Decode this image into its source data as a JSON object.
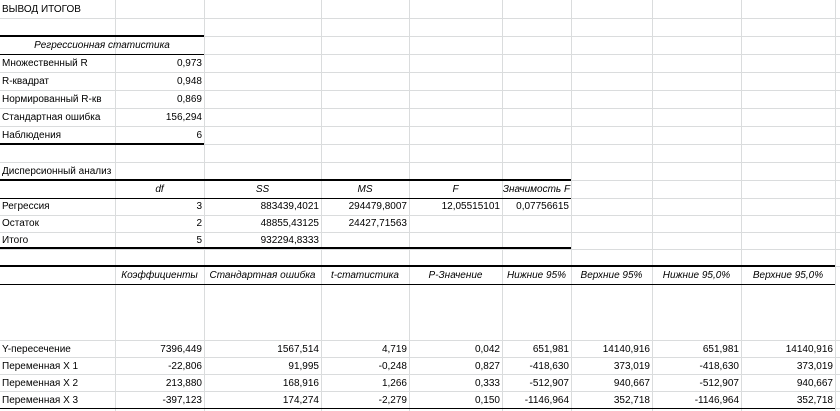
{
  "title": "ВЫВОД ИТОГОВ",
  "regression_stats": {
    "header": "Регрессионная статистика",
    "rows": [
      {
        "label": "Множественный R",
        "value": "0,973"
      },
      {
        "label": "R-квадрат",
        "value": "0,948"
      },
      {
        "label": "Нормированный R-кв",
        "value": "0,869"
      },
      {
        "label": "Стандартная ошибка",
        "value": "156,294"
      },
      {
        "label": "Наблюдения",
        "value": "6"
      }
    ]
  },
  "anova": {
    "title": "Дисперсионный анализ",
    "headers": [
      "df",
      "SS",
      "MS",
      "F",
      "Значимость F"
    ],
    "rows": [
      {
        "label": "Регрессия",
        "df": "3",
        "ss": "883439,4021",
        "ms": "294479,8007",
        "f": "12,05515101",
        "sig": "0,07756615"
      },
      {
        "label": "Остаток",
        "df": "2",
        "ss": "48855,43125",
        "ms": "24427,71563",
        "f": "",
        "sig": ""
      },
      {
        "label": "Итого",
        "df": "5",
        "ss": "932294,8333",
        "ms": "",
        "f": "",
        "sig": ""
      }
    ]
  },
  "coefficients": {
    "headers": [
      "Коэффициенты",
      "Стандартная ошибка",
      "t-статистика",
      "P-Значение",
      "Нижние 95%",
      "Верхние 95%",
      "Нижние 95,0%",
      "Верхние 95,0%"
    ],
    "rows": [
      {
        "label": "Y-пересечение",
        "values": [
          "7396,449",
          "1567,514",
          "4,719",
          "0,042",
          "651,981",
          "14140,916",
          "651,981",
          "14140,916"
        ]
      },
      {
        "label": "Переменная X 1",
        "values": [
          "-22,806",
          "91,995",
          "-0,248",
          "0,827",
          "-418,630",
          "373,019",
          "-418,630",
          "373,019"
        ]
      },
      {
        "label": "Переменная X 2",
        "values": [
          "213,880",
          "168,916",
          "1,266",
          "0,333",
          "-512,907",
          "940,667",
          "-512,907",
          "940,667"
        ]
      },
      {
        "label": "Переменная X 3",
        "values": [
          "-397,123",
          "174,274",
          "-2,279",
          "0,150",
          "-1146,964",
          "352,718",
          "-1146,964",
          "352,718"
        ]
      }
    ]
  }
}
